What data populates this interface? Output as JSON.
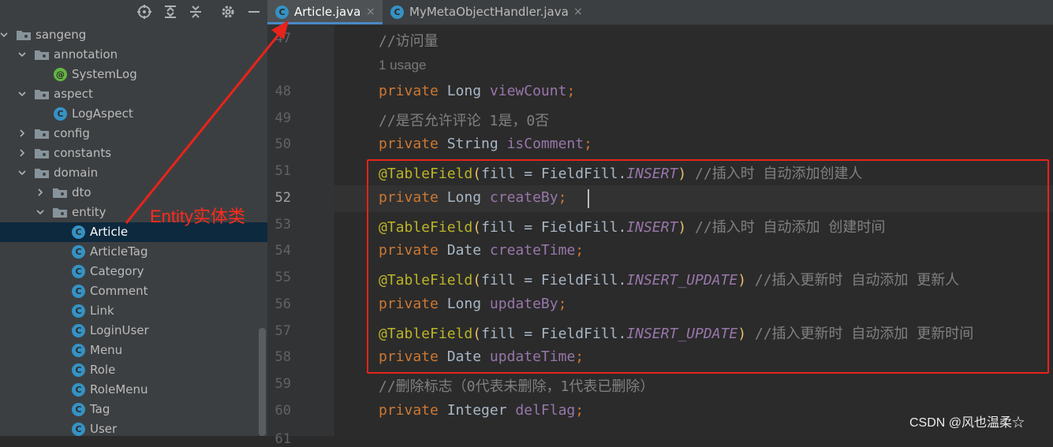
{
  "tree": {
    "toolbar_icons": [
      "crosshair-icon",
      "expand-all-icon",
      "collapse-all-icon",
      "gear-icon",
      "minimize-icon"
    ],
    "items": [
      {
        "label": "sangeng",
        "type": "package",
        "expanded": true
      },
      {
        "label": "annotation",
        "type": "package",
        "expanded": true
      },
      {
        "label": "SystemLog",
        "type": "annotation"
      },
      {
        "label": "aspect",
        "type": "package",
        "expanded": true
      },
      {
        "label": "LogAspect",
        "type": "class"
      },
      {
        "label": "config",
        "type": "package",
        "expanded": false
      },
      {
        "label": "constants",
        "type": "package",
        "expanded": false
      },
      {
        "label": "domain",
        "type": "package",
        "expanded": true
      },
      {
        "label": "dto",
        "type": "package",
        "expanded": false
      },
      {
        "label": "entity",
        "type": "package",
        "expanded": true
      },
      {
        "label": "Article",
        "type": "class",
        "selected": true
      },
      {
        "label": "ArticleTag",
        "type": "class"
      },
      {
        "label": "Category",
        "type": "class"
      },
      {
        "label": "Comment",
        "type": "class"
      },
      {
        "label": "Link",
        "type": "class"
      },
      {
        "label": "LoginUser",
        "type": "class"
      },
      {
        "label": "Menu",
        "type": "class"
      },
      {
        "label": "Role",
        "type": "class"
      },
      {
        "label": "RoleMenu",
        "type": "class"
      },
      {
        "label": "Tag",
        "type": "class"
      },
      {
        "label": "User",
        "type": "class"
      }
    ]
  },
  "tabs": [
    {
      "label": "Article.java",
      "icon": "C",
      "active": true,
      "close": "×"
    },
    {
      "label": "MyMetaObjectHandler.java",
      "icon": "C",
      "active": false,
      "close": "×"
    }
  ],
  "editor": {
    "usage_hint": "1 usage",
    "current_line": "52",
    "lines": [
      {
        "num": "47",
        "text": "//访问量"
      },
      {
        "num": "48",
        "text": "private Long viewCount;"
      },
      {
        "num": "49",
        "text": "//是否允许评论 1是，0否"
      },
      {
        "num": "50",
        "text": "private String isComment;"
      },
      {
        "num": "51",
        "text": "@TableField(fill = FieldFill.INSERT) //插入时 自动添加创建人"
      },
      {
        "num": "52",
        "text": "private Long createBy;"
      },
      {
        "num": "53",
        "text": "@TableField(fill = FieldFill.INSERT) //插入时 自动添加 创建时间"
      },
      {
        "num": "54",
        "text": "private Date createTime;"
      },
      {
        "num": "55",
        "text": "@TableField(fill = FieldFill.INSERT_UPDATE) //插入更新时 自动添加 更新人"
      },
      {
        "num": "56",
        "text": "private Long updateBy;"
      },
      {
        "num": "57",
        "text": "@TableField(fill = FieldFill.INSERT_UPDATE) //插入更新时 自动添加 更新时间"
      },
      {
        "num": "58",
        "text": "private Date updateTime;"
      },
      {
        "num": "59",
        "text": "//删除标志（0代表未删除，1代表已删除）"
      },
      {
        "num": "60",
        "text": "private Integer delFlag;"
      },
      {
        "num": "61",
        "text": ""
      }
    ]
  },
  "annotation": {
    "label": "Entity实体类",
    "color": "#e8231c"
  },
  "watermark": "CSDN @风也温柔☆",
  "colors": {
    "keyword": "#cc7832",
    "field": "#9876aa",
    "annotation": "#bbb529",
    "comment": "#808080",
    "selection": "#0d293e",
    "class_icon": "#3592c4"
  }
}
